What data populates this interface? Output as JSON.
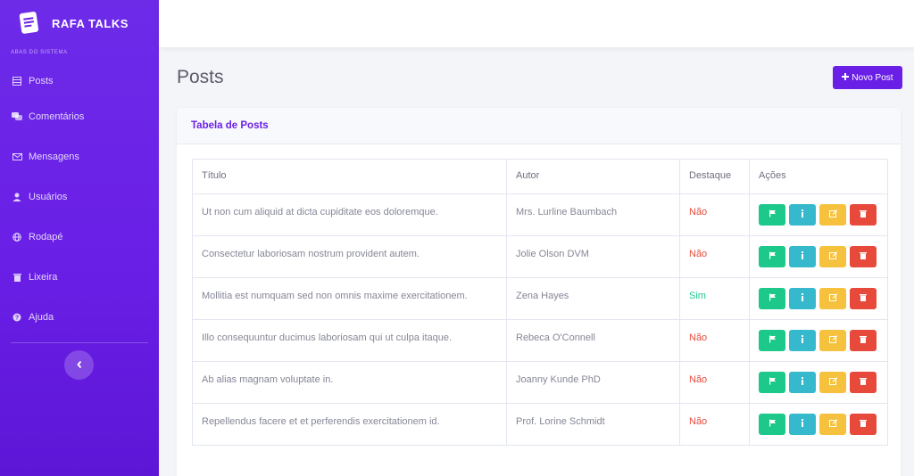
{
  "brand": {
    "name": "RAFA TALKS",
    "logo_icon": "notebook-icon"
  },
  "sidebar": {
    "heading": "ABAS DO SISTEMA",
    "items": [
      {
        "label": "Posts",
        "icon": "table-icon"
      },
      {
        "label": "Comentários",
        "icon": "comments-icon"
      },
      {
        "label": "Mensagens",
        "icon": "envelope-icon"
      },
      {
        "label": "Usuários",
        "icon": "user-icon"
      },
      {
        "label": "Rodapé",
        "icon": "globe-icon"
      },
      {
        "label": "Lixeira",
        "icon": "trash-icon"
      },
      {
        "label": "Ajuda",
        "icon": "question-icon"
      }
    ],
    "collapse_icon": "chevron-left-icon"
  },
  "page": {
    "title": "Posts",
    "new_post_label": "Novo Post"
  },
  "table": {
    "card_title": "Tabela de Posts",
    "columns": [
      "Título",
      "Autor",
      "Destaque",
      "Ações"
    ],
    "rows": [
      {
        "title": "Ut non cum aliquid at dicta cupiditate eos doloremque.",
        "author": "Mrs. Lurline Baumbach",
        "featured": "Não"
      },
      {
        "title": "Consectetur laboriosam nostrum provident autem.",
        "author": "Jolie Olson DVM",
        "featured": "Não"
      },
      {
        "title": "Mollitia est numquam sed non omnis maxime exercitationem.",
        "author": "Zena Hayes",
        "featured": "Sim"
      },
      {
        "title": "Illo consequuntur ducimus laboriosam qui ut culpa itaque.",
        "author": "Rebeca O'Connell",
        "featured": "Não"
      },
      {
        "title": "Ab alias magnam voluptate in.",
        "author": "Joanny Kunde PhD",
        "featured": "Não"
      },
      {
        "title": "Repellendus facere et et perferendis exercitationem id.",
        "author": "Prof. Lorine Schmidt",
        "featured": "Não"
      }
    ],
    "action_icons": [
      "flag-icon",
      "info-icon",
      "edit-icon",
      "trash-icon"
    ]
  },
  "colors": {
    "brand": "#6a1fe6",
    "no": "#e74a3b",
    "yes": "#1cc88a",
    "action_green": "#1cc88a",
    "action_cyan": "#36b9cc",
    "action_yellow": "#f6c23e",
    "action_red": "#e74a3b"
  }
}
